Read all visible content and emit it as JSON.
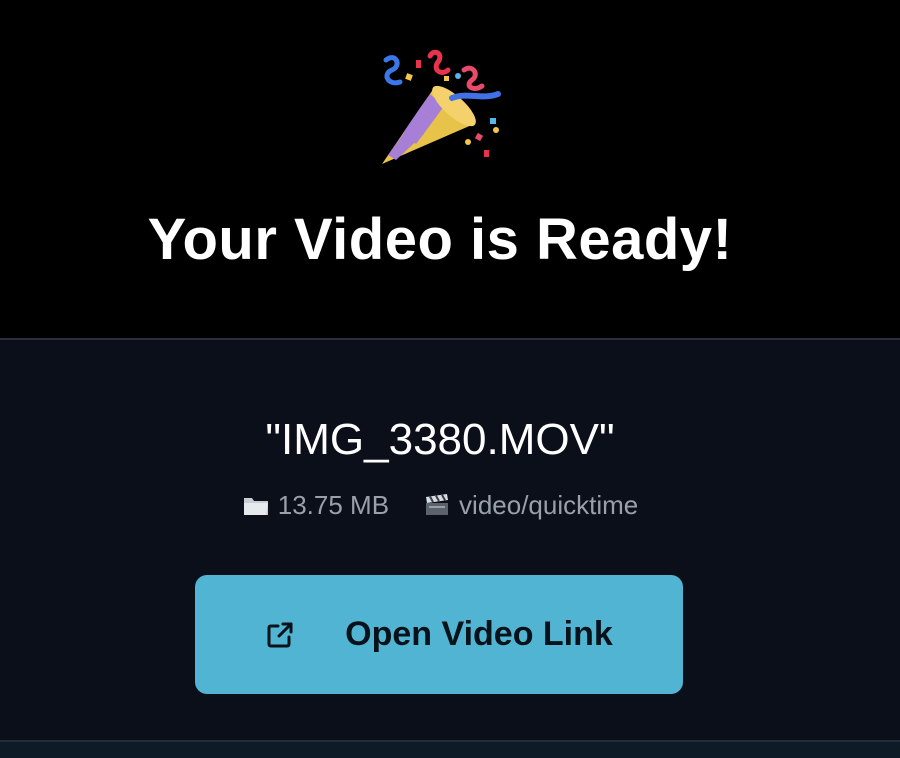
{
  "hero": {
    "icon": "party-popper-icon",
    "title": "Your Video is Ready!"
  },
  "file": {
    "name": "\"IMG_3380.MOV\"",
    "size_icon": "folder-icon",
    "size": "13.75 MB",
    "type_icon": "clapperboard-icon",
    "type": "video/quicktime"
  },
  "action": {
    "icon": "external-link-icon",
    "label": "Open Video Link"
  },
  "colors": {
    "background": "#000000",
    "card": "#0b0f1a",
    "button": "#52b4d3",
    "button_text": "#07121a",
    "meta_text": "#9aa0aa"
  }
}
